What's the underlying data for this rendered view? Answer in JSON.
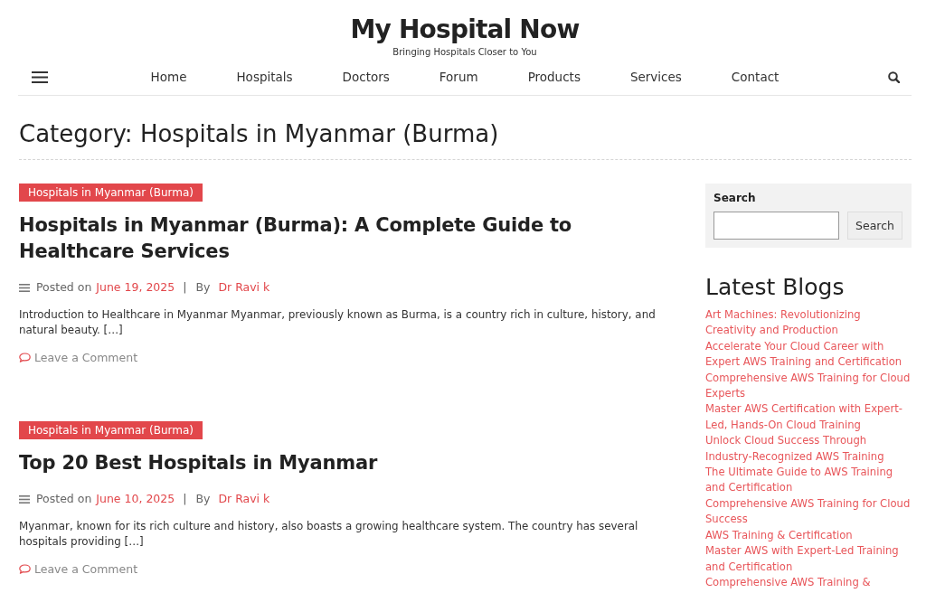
{
  "site": {
    "title": "My Hospital Now",
    "tagline": "Bringing Hospitals Closer to You"
  },
  "nav": {
    "items": [
      {
        "label": "Home"
      },
      {
        "label": "Hospitals"
      },
      {
        "label": "Doctors"
      },
      {
        "label": "Forum"
      },
      {
        "label": "Products"
      },
      {
        "label": "Services"
      },
      {
        "label": "Contact"
      }
    ]
  },
  "page_title": "Category: Hospitals in Myanmar (Burma)",
  "posts": [
    {
      "category": "Hospitals in Myanmar (Burma)",
      "title": "Hospitals in Myanmar (Burma): A Complete Guide to Healthcare Services",
      "posted_label": "Posted on",
      "date": "June 19, 2025",
      "separator": "|",
      "by_label": "By",
      "author": "Dr Ravi k",
      "excerpt": "Introduction to Healthcare in Myanmar Myanmar, previously known as Burma, is a country rich in culture, history, and natural beauty. […]",
      "comment_link": "Leave a Comment"
    },
    {
      "category": "Hospitals in Myanmar (Burma)",
      "title": "Top 20 Best Hospitals in Myanmar",
      "posted_label": "Posted on",
      "date": "June 10, 2025",
      "separator": "|",
      "by_label": "By",
      "author": "Dr Ravi k",
      "excerpt": "Myanmar, known for its rich culture and history, also boasts a growing healthcare system. The country has several hospitals providing […]",
      "comment_link": "Leave a Comment"
    }
  ],
  "sidebar": {
    "search": {
      "label": "Search",
      "button": "Search"
    },
    "latest_blogs": {
      "title": "Latest Blogs",
      "items": [
        "Art Machines: Revolutionizing Creativity and Production",
        "Accelerate Your Cloud Career with Expert AWS Training and Certification",
        "Comprehensive AWS Training for Cloud Experts",
        "Master AWS Certification with Expert-Led, Hands-On Cloud Training",
        "Unlock Cloud Success Through Industry-Recognized AWS Training",
        "The Ultimate Guide to AWS Training and Certification",
        "Comprehensive AWS Training for Cloud Success",
        "AWS Training & Certification",
        "Master AWS with Expert-Led Training and Certification",
        "Comprehensive AWS Training &"
      ]
    }
  }
}
